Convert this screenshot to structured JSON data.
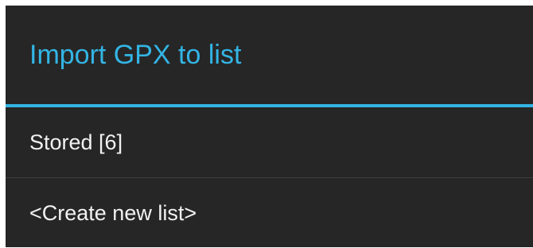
{
  "dialog": {
    "title": "Import GPX to list",
    "accent_color": "#33b5e5",
    "items": [
      {
        "label": "Stored [6]"
      },
      {
        "label": "<Create new list>"
      }
    ]
  }
}
